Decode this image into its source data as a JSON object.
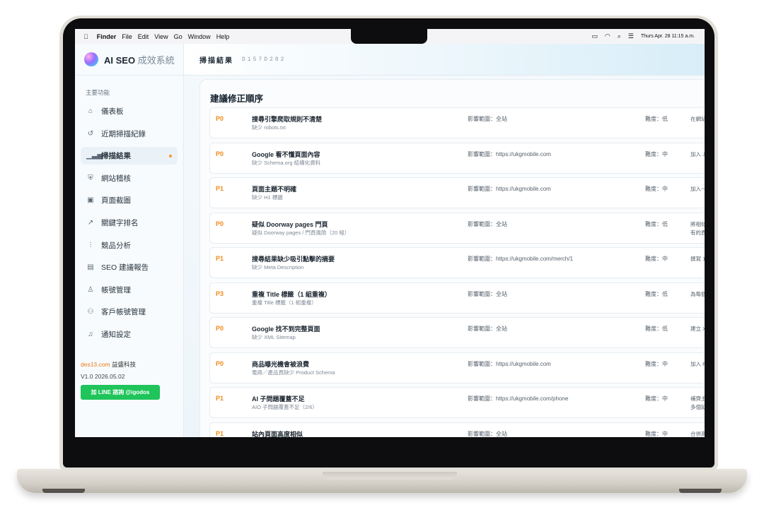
{
  "menubar": {
    "apple": "",
    "items": [
      "Finder",
      "File",
      "Edit",
      "View",
      "Go",
      "Window",
      "Help"
    ],
    "datetime": "Thurs Apr. 28 11:15 a.m."
  },
  "brand": {
    "name_bold": "AI SEO",
    "name_thin": "成效系統"
  },
  "sidebar": {
    "section_title": "主要功能",
    "items": [
      {
        "label": "儀表板",
        "icon": "home-icon"
      },
      {
        "label": "近期掃描紀錄",
        "icon": "history-icon"
      },
      {
        "label": "掃描結果",
        "icon": "bar-chart-icon"
      },
      {
        "label": "網站稽核",
        "icon": "shield-icon"
      },
      {
        "label": "頁面截圖",
        "icon": "image-icon"
      },
      {
        "label": "關鍵字排名",
        "icon": "trend-icon"
      },
      {
        "label": "競品分析",
        "icon": "bars-icon"
      },
      {
        "label": "SEO 建議報告",
        "icon": "document-icon"
      },
      {
        "label": "帳號管理",
        "icon": "user-icon"
      },
      {
        "label": "客戶帳號管理",
        "icon": "users-icon"
      },
      {
        "label": "通知設定",
        "icon": "bell-icon"
      }
    ],
    "company_domain": "des13.com",
    "company_name": "益盛科技",
    "version": "V1.0",
    "date": "2026.05.02",
    "line_button": "加 LINE 諮詢 @igodos"
  },
  "topbar": {
    "title": "掃描結果",
    "scan_id": "D157D282"
  },
  "card": {
    "title": "建議修正順序"
  },
  "impact_label": "影響範圍：",
  "difficulty_label": "難度：",
  "rows": [
    {
      "priority": "P0",
      "title": "搜尋引擎爬取規則不清楚",
      "sub": "缺少 robots.txt",
      "impact": "全站",
      "difficulty": "低",
      "action": "在網站"
    },
    {
      "priority": "P0",
      "title": "Google 看不懂頁面內容",
      "sub": "缺少 Schema.org 結構化資料",
      "impact": "https://ukgmobile.com",
      "difficulty": "中",
      "action": "加入 J"
    },
    {
      "priority": "P1",
      "title": "頁面主題不明確",
      "sub": "缺少 H1 標題",
      "impact": "https://ukgmobile.com",
      "difficulty": "中",
      "action": "加入一"
    },
    {
      "priority": "P0",
      "title": "疑似 Doorway pages 門頁",
      "sub": "疑似 Doorway pages / 門頁風險（20 組）",
      "impact": "全站",
      "difficulty": "低",
      "action": "將相似\n有的頁"
    },
    {
      "priority": "P1",
      "title": "搜尋結果缺少吸引點擊的摘要",
      "sub": "缺少 Meta Description",
      "impact": "https://ukgmobile.com/merch/1",
      "difficulty": "中",
      "action": "撰寫 1"
    },
    {
      "priority": "P3",
      "title": "重複 Title 標籤（1 組重複）",
      "sub": "重複 Title 標籤（1 組重複）",
      "impact": "全站",
      "difficulty": "低",
      "action": "為每個"
    },
    {
      "priority": "P0",
      "title": "Google 找不到完整頁面",
      "sub": "缺少 XML Sitemap",
      "impact": "全站",
      "difficulty": "低",
      "action": "建立 X"
    },
    {
      "priority": "P0",
      "title": "商品曝光機會被浪費",
      "sub": "電商／產品頁缺少 Product Schema",
      "impact": "https://ukgmobile.com",
      "difficulty": "中",
      "action": "加入 P"
    },
    {
      "priority": "P1",
      "title": "AI 子問題覆蓋不足",
      "sub": "AIO 子問題覆蓋不足（2/6）",
      "impact": "https://ukgmobile.com/phone",
      "difficulty": "中",
      "action": "補齊主\n多個延"
    },
    {
      "priority": "P1",
      "title": "站內頁面高度相似",
      "sub": "",
      "impact": "全站",
      "difficulty": "中",
      "action": "合併高"
    }
  ]
}
